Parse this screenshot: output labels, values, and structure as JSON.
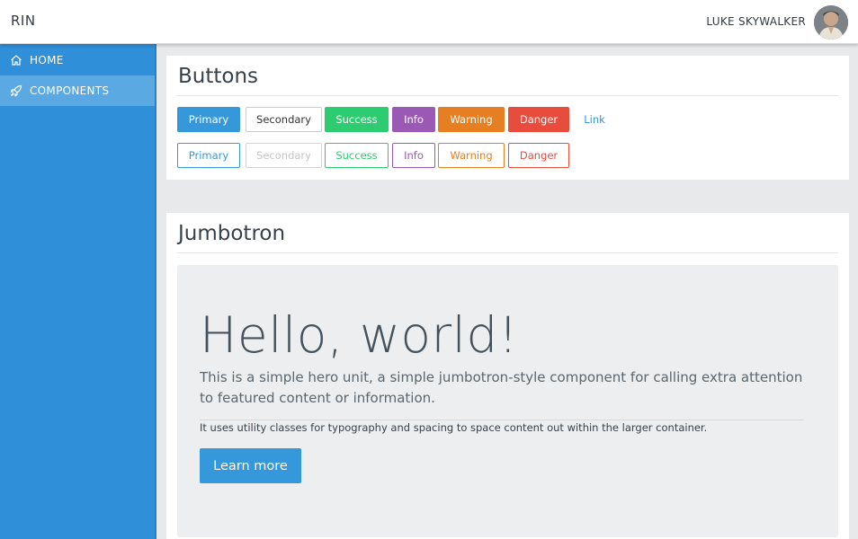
{
  "navbar": {
    "brand": "RIN",
    "user_name": "LUKE SKYWALKER"
  },
  "sidebar": {
    "items": [
      {
        "label": "HOME",
        "icon": "home-icon"
      },
      {
        "label": "COMPONENTS",
        "icon": "rocket-icon"
      }
    ]
  },
  "buttons_card": {
    "title": "Buttons",
    "solid": [
      "Primary",
      "Secondary",
      "Success",
      "Info",
      "Warning",
      "Danger",
      "Link"
    ],
    "outline": [
      "Primary",
      "Secondary",
      "Success",
      "Info",
      "Warning",
      "Danger"
    ]
  },
  "jumbotron_card": {
    "title": "Jumbotron",
    "heading": "Hello, world!",
    "lead": "This is a simple hero unit, a simple jumbotron-style component for calling extra attention to featured content or information.",
    "text": "It uses utility classes for typography and spacing to space content out within the larger container.",
    "button": "Learn more"
  },
  "colors": {
    "primary": "#3498db",
    "success": "#2ecc71",
    "info": "#9b59b6",
    "warning": "#e67e22",
    "danger": "#e74c3c",
    "sidebar": "#2f8fd8"
  }
}
